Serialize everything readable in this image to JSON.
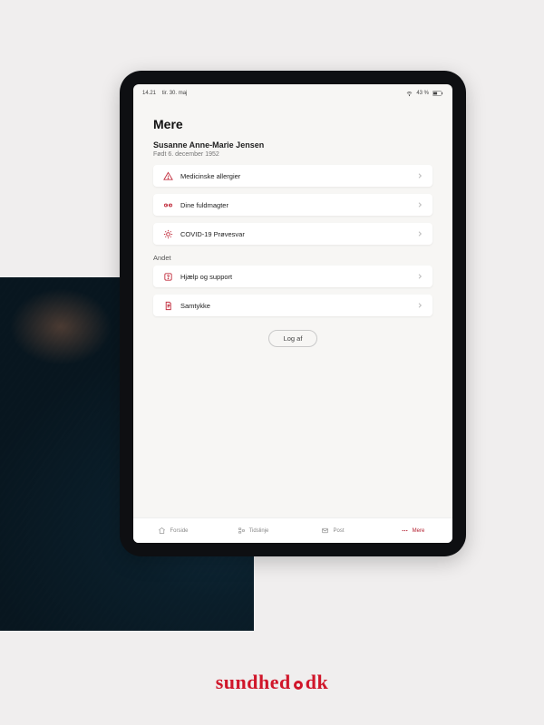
{
  "brand": {
    "name_left": "sundhed",
    "name_right": "dk"
  },
  "statusbar": {
    "time": "14.21",
    "date": "tir. 30. maj",
    "battery": "43 %"
  },
  "page": {
    "title": "Mere",
    "user_name": "Susanne Anne-Marie Jensen",
    "user_sub": "Født 6. december 1952"
  },
  "section1": {
    "items": [
      {
        "label": "Medicinske allergier"
      },
      {
        "label": "Dine fuldmagter"
      },
      {
        "label": "COVID-19 Prøvesvar"
      }
    ]
  },
  "section2": {
    "title": "Andet",
    "items": [
      {
        "label": "Hjælp og support"
      },
      {
        "label": "Samtykke"
      }
    ]
  },
  "logout": {
    "label": "Log af"
  },
  "tabs": {
    "home": "Forside",
    "timeline": "Tidslinje",
    "post": "Post",
    "more": "Mere"
  }
}
